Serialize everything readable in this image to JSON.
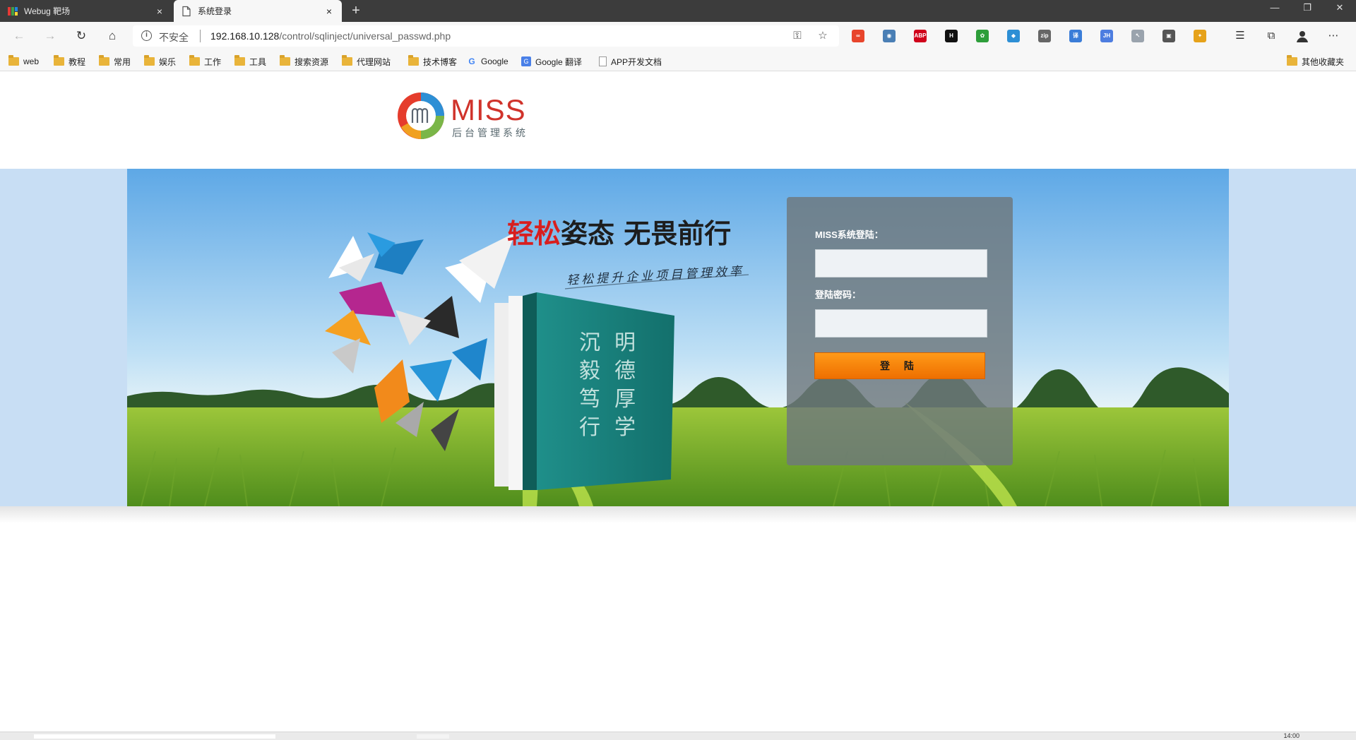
{
  "browser": {
    "tabs": [
      {
        "title": "Webug 靶场",
        "active": false
      },
      {
        "title": "系统登录",
        "active": true
      }
    ],
    "new_tab_symbol": "+",
    "tab_close_symbol": "×",
    "window_controls": [
      "minimize-icon",
      "restore-icon",
      "close-icon"
    ],
    "address": {
      "security_label": "不安全",
      "url_host": "192.168.10.128",
      "url_path": "/control/sqlinject/universal_passwd.php"
    },
    "bookmarks": [
      {
        "label": "web",
        "icon": "folder-icon"
      },
      {
        "label": "教程",
        "icon": "folder-icon"
      },
      {
        "label": "常用",
        "icon": "folder-icon"
      },
      {
        "label": "娱乐",
        "icon": "folder-icon"
      },
      {
        "label": "工作",
        "icon": "folder-icon"
      },
      {
        "label": "工具",
        "icon": "folder-icon"
      },
      {
        "label": "搜索资源",
        "icon": "folder-icon"
      },
      {
        "label": "代理网站",
        "icon": "folder-icon"
      },
      {
        "label": "技术博客",
        "icon": "folder-icon"
      },
      {
        "label": "Google",
        "icon": "google-icon"
      },
      {
        "label": "Google 翻译",
        "icon": "google-translate-icon"
      },
      {
        "label": "APP开发文档",
        "icon": "page-icon"
      }
    ],
    "other_bookmarks": "其他收藏夹",
    "extensions": [
      {
        "name": "ext-infinity-icon",
        "color": "#e8452c",
        "text": "∞"
      },
      {
        "name": "ext-owl-icon",
        "color": "#4a7fb5",
        "text": "◉"
      },
      {
        "name": "ext-adblock-icon",
        "color": "#d0021b",
        "text": "ABP"
      },
      {
        "name": "ext-h-icon",
        "color": "#111111",
        "text": "H"
      },
      {
        "name": "ext-paw-icon",
        "color": "#2e9e3a",
        "text": "✿"
      },
      {
        "name": "ext-shield-icon",
        "color": "#2d8fd5",
        "text": "◆"
      },
      {
        "name": "ext-gitzip-icon",
        "color": "#666666",
        "text": "zip"
      },
      {
        "name": "ext-translate-icon",
        "color": "#3b7dd8",
        "text": "译"
      },
      {
        "name": "ext-jh-icon",
        "color": "#4d7de0",
        "text": "JH"
      },
      {
        "name": "ext-cursor-icon",
        "color": "#9aa3ad",
        "text": "↖"
      },
      {
        "name": "ext-chat-icon",
        "color": "#555555",
        "text": "▣"
      },
      {
        "name": "ext-pinwheel-icon",
        "color": "#e6a21a",
        "text": "✦"
      }
    ],
    "status_clock": "14:00"
  },
  "page": {
    "logo": {
      "brand": "MISS",
      "subtitle": "后台管理系统"
    },
    "banner": {
      "slogan_red": "轻松",
      "slogan_rest": "姿态 无畏前行",
      "subslogan": "轻松提升企业项目管理效率",
      "book_text": [
        "明",
        "德",
        "厚",
        "学",
        "沉",
        "毅",
        "笃",
        "行"
      ]
    },
    "login": {
      "username_label": "MISS系统登陆：",
      "username_value": "",
      "password_label": "登陆密码：",
      "password_value": "",
      "submit_label": "登 陆"
    }
  }
}
